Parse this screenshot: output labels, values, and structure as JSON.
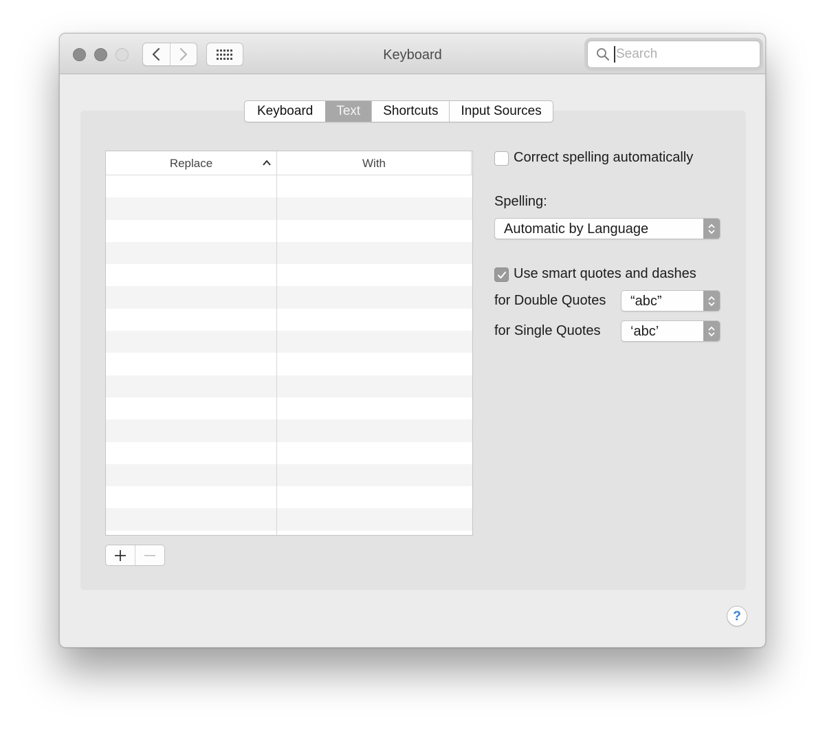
{
  "window": {
    "title": "Keyboard"
  },
  "search": {
    "placeholder": "Search"
  },
  "tabs": [
    {
      "label": "Keyboard"
    },
    {
      "label": "Text",
      "active": true
    },
    {
      "label": "Shortcuts"
    },
    {
      "label": "Input Sources"
    }
  ],
  "table": {
    "columns": [
      "Replace",
      "With"
    ],
    "sorted_column": "Replace",
    "sort_direction": "ascending",
    "rows": []
  },
  "options": {
    "correct_spelling": {
      "label": "Correct spelling automatically",
      "checked": false
    },
    "spelling": {
      "label": "Spelling:",
      "value": "Automatic by Language"
    },
    "smart_quotes": {
      "label": "Use smart quotes and dashes",
      "checked": true
    },
    "double_quotes": {
      "label": "for Double Quotes",
      "value": "“abc”"
    },
    "single_quotes": {
      "label": "for Single Quotes",
      "value": "‘abc’"
    }
  },
  "help": {
    "label": "?"
  },
  "icons": {
    "back": "chevron-left-icon",
    "forward": "chevron-right-icon",
    "grid": "grid-icon",
    "search": "search-icon",
    "add": "plus-icon",
    "remove": "minus-icon",
    "sort": "chevron-up-icon"
  },
  "colors": {
    "window_bg": "#ececec",
    "active_tab": "#a8a8a8",
    "help_accent": "#3b82d6"
  }
}
